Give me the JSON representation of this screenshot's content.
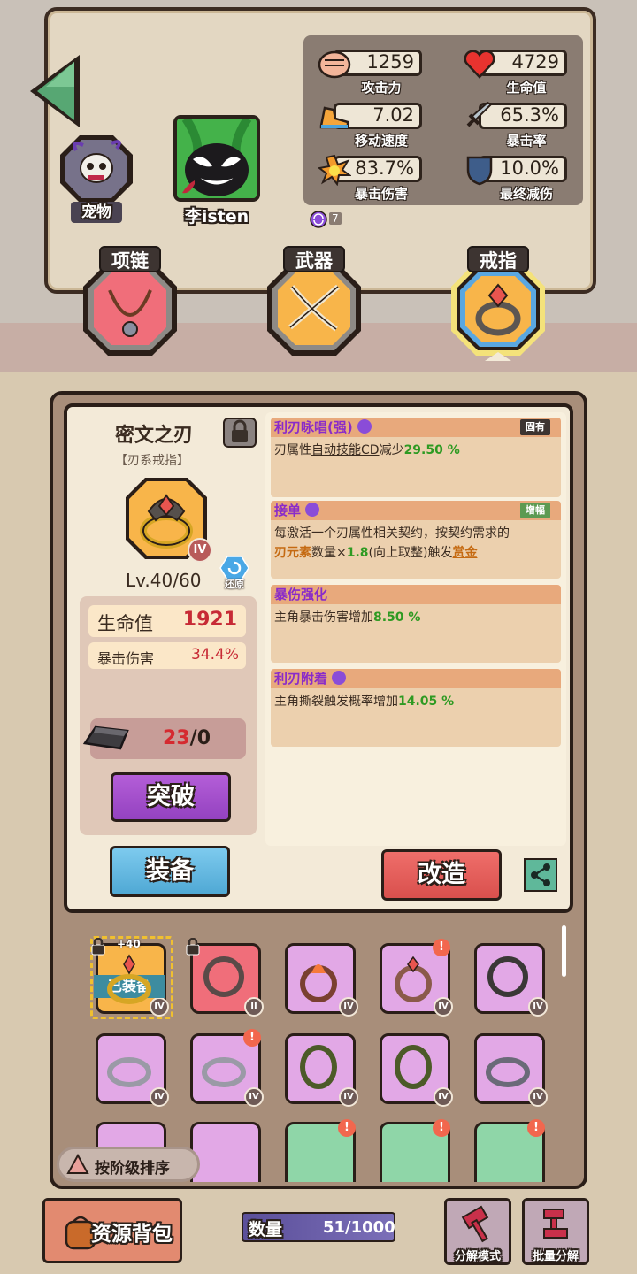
{
  "stats": [
    {
      "value": "1259",
      "label": "攻击力",
      "icon": "fist-icon"
    },
    {
      "value": "4729",
      "label": "生命值",
      "icon": "heart-icon"
    },
    {
      "value": "7.02",
      "label": "移动速度",
      "icon": "shoe-icon"
    },
    {
      "value": "65.3%",
      "label": "暴击率",
      "icon": "sword-icon"
    },
    {
      "value": "83.7%",
      "label": "暴击伤害",
      "icon": "explosion-icon"
    },
    {
      "value": "10.0%",
      "label": "最终减伤",
      "icon": "shield-icon"
    }
  ],
  "pet_label": "宠物",
  "player_name": "李isten",
  "badge_count": "7",
  "slots": {
    "necklace": "项链",
    "weapon": "武器",
    "ring": "戒指"
  },
  "item": {
    "name": "密文之刃",
    "type": "【刃系戒指】",
    "tier": "IV",
    "level": "Lv.40/60",
    "restore": "还原",
    "stat1_label": "生命值",
    "stat1_value": "1921",
    "stat2_label": "暴击伤害",
    "stat2_value": "34.4%",
    "mat_have": "23",
    "mat_need": "/0",
    "breakthrough": "突破"
  },
  "affixes": {
    "a1_title": "利刃咏唱(强)",
    "a1_tag": "固有",
    "a1_text": "刃属性",
    "a1_link": "自动技能CD",
    "a1_text2": "减少",
    "a1_value": "29.50 %",
    "a2_title": "接单",
    "a2_tag": "增幅",
    "a2_line1": "每激活一个刃属性相关契约，按契约需求的",
    "a2_el": "刃元素",
    "a2_mid": "数量×",
    "a2_mult": "1.8",
    "a2_mid2": "(向上取整)触发",
    "a2_reward": "赏金",
    "a3_title": "暴伤强化",
    "a3_text": "主角暴击伤害增加",
    "a3_value": "8.50 %",
    "a4_title": "利刃附着",
    "a4_text": "主角撕裂触发概率增加",
    "a4_value": "14.05 %"
  },
  "actions": {
    "equip": "装备",
    "reforge": "改造"
  },
  "inventory": {
    "equipped_label": "已装备",
    "plus": "+40",
    "items": [
      {
        "tier": "IV"
      },
      {
        "tier": "II"
      },
      {
        "tier": "IV"
      },
      {
        "tier": "IV"
      },
      {
        "tier": "IV"
      },
      {
        "tier": "IV"
      },
      {
        "tier": "IV"
      },
      {
        "tier": "IV"
      },
      {
        "tier": "IV"
      },
      {
        "tier": "IV"
      },
      {
        "tier": ""
      },
      {
        "tier": ""
      },
      {
        "tier": ""
      },
      {
        "tier": ""
      },
      {
        "tier": ""
      }
    ],
    "sort_label": "按阶级排序"
  },
  "footer": {
    "bag": "资源背包",
    "count_label": "数量",
    "count_value": "51/1000",
    "dismantle_mode": "分解模式",
    "batch_dismantle": "批量分解"
  },
  "colors": {
    "accent_green": "#2e9a22",
    "purple": "#8a2bc9",
    "red_btn": "#e05a58",
    "blue_btn": "#5fb6d9"
  }
}
